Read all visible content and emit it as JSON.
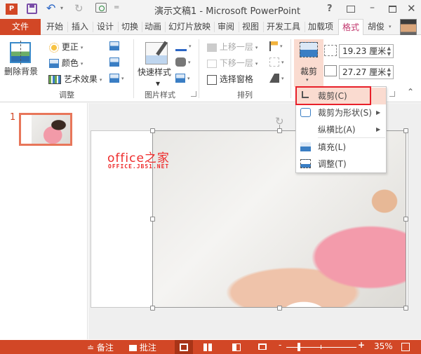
{
  "window": {
    "title": "演示文稿1 - Microsoft PowerPoint",
    "app_icon": "P",
    "help": "?",
    "controls": {
      "minimize": "–",
      "close": "✕"
    }
  },
  "qat": {
    "undo_glyph": "↶",
    "redo_glyph": "↻",
    "dropdown": "▾",
    "customize": "="
  },
  "tabs": [
    {
      "label": "文件"
    },
    {
      "label": "开始"
    },
    {
      "label": "插入"
    },
    {
      "label": "设计"
    },
    {
      "label": "切换"
    },
    {
      "label": "动画"
    },
    {
      "label": "幻灯片放映"
    },
    {
      "label": "审阅"
    },
    {
      "label": "视图"
    },
    {
      "label": "开发工具"
    },
    {
      "label": "加载项"
    },
    {
      "label": "格式"
    }
  ],
  "active_tab": "格式",
  "user": {
    "name": "胡俊",
    "dropdown": "▾"
  },
  "ribbon": {
    "adjust": {
      "label": "调整",
      "remove_background": "删除背景",
      "corrections": "更正",
      "color": "颜色",
      "artistic_effects": "艺术效果",
      "dropdown": "▾"
    },
    "picture_styles": {
      "label": "图片样式",
      "quick_styles": "快速样式"
    },
    "arrange": {
      "label": "排列",
      "bring_forward": "上移一层",
      "send_backward": "下移一层",
      "selection_pane": "选择窗格"
    },
    "size": {
      "crop": "裁剪",
      "height": "19.23 厘米",
      "width": "27.27 厘米",
      "collapse": "⌃"
    }
  },
  "crop_menu": {
    "items": [
      {
        "label": "裁剪(C)",
        "icon": "crop-icon",
        "highlighted": true
      },
      {
        "label": "裁剪为形状(S)",
        "icon": "crop-to-shape-icon",
        "submenu": true
      },
      {
        "label": "纵横比(A)",
        "icon": "",
        "submenu": true
      },
      {
        "label": "填充(L)",
        "icon": "fill-icon"
      },
      {
        "label": "调整(T)",
        "icon": "fit-icon"
      }
    ],
    "submenu_arrow": "▶"
  },
  "thumbnails": {
    "slide_number": "1"
  },
  "slide": {
    "watermark_main": "office之家",
    "watermark_sub": "OFFICE.JB51.NET",
    "rotate_glyph": "↻"
  },
  "statusbar": {
    "notes": "备注",
    "comments": "批注",
    "notes_glyph": "≐",
    "zoom_minus": "-",
    "zoom_plus": "+",
    "zoom_percent": "35%"
  },
  "colors": {
    "accent": "#d24726",
    "active_tab_text": "#c1366d",
    "crop_highlight": "#fadbd0",
    "annotation_box": "#e8202a"
  }
}
